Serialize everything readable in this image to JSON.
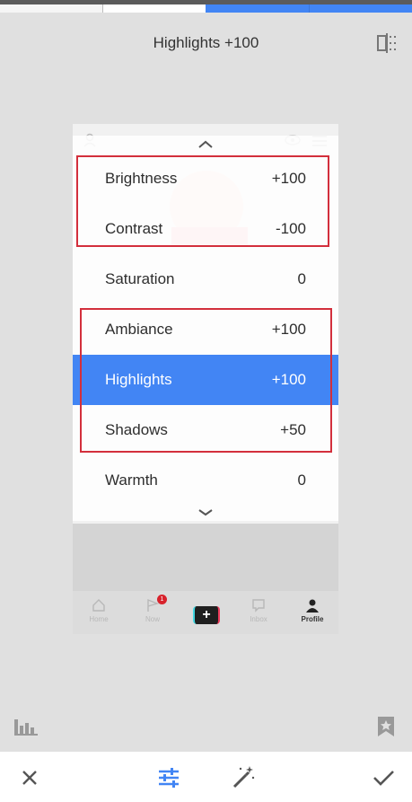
{
  "status_bar": {
    "colors": [
      "#f5f5f5",
      "#ffffff",
      "#4285f4",
      "#4285f4"
    ]
  },
  "header": {
    "title": "Highlights +100",
    "compare_icon": "split-compare-icon"
  },
  "preview": {
    "bottom_nav": [
      {
        "label": "Home",
        "icon": "home-icon"
      },
      {
        "label": "Now",
        "icon": "flag-icon",
        "badge": "1"
      },
      {
        "label": "",
        "icon": "plus-icon"
      },
      {
        "label": "Inbox",
        "icon": "inbox-icon"
      },
      {
        "label": "Profile",
        "icon": "profile-icon"
      }
    ],
    "plus_label": "+"
  },
  "menu": {
    "items": [
      {
        "label": "Brightness",
        "value": "+100"
      },
      {
        "label": "Contrast",
        "value": "-100"
      },
      {
        "label": "Saturation",
        "value": "0"
      },
      {
        "label": "Ambiance",
        "value": "+100"
      },
      {
        "label": "Highlights",
        "value": "+100",
        "active": true
      },
      {
        "label": "Shadows",
        "value": "+50"
      },
      {
        "label": "Warmth",
        "value": "0"
      }
    ],
    "active_color": "#4285f4"
  },
  "annotations": {
    "box_color": "#d32f3c"
  },
  "toolbar": {
    "cancel_icon": "close-icon",
    "tune_icon": "sliders-icon",
    "auto_icon": "magic-wand-icon",
    "apply_icon": "check-icon",
    "accent": "#4285f4"
  }
}
